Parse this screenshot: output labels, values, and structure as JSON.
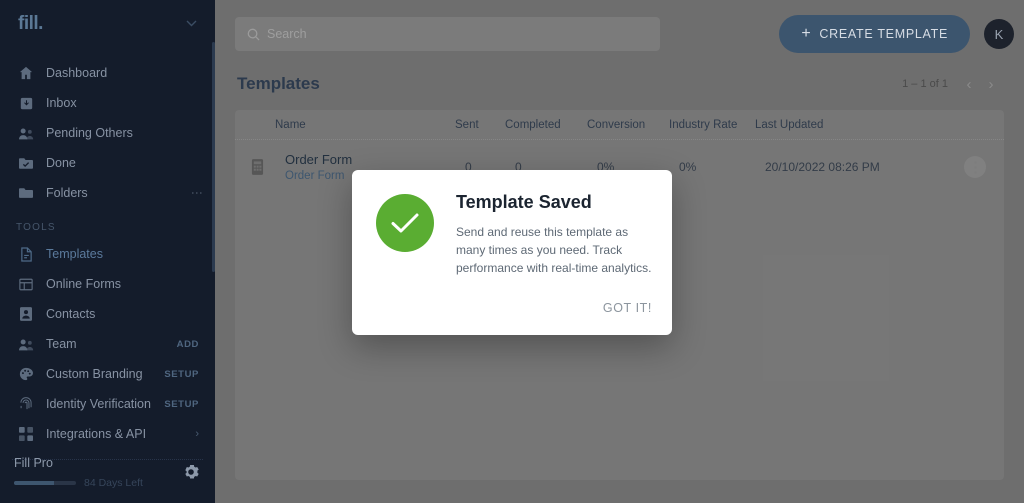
{
  "sidebar": {
    "logo": "fill.",
    "logo_chevron": "chevron-down",
    "nav_primary": [
      {
        "label": "Dashboard",
        "icon": "home-icon"
      },
      {
        "label": "Inbox",
        "icon": "inbox-icon"
      },
      {
        "label": "Pending Others",
        "icon": "pending-users-icon"
      },
      {
        "label": "Done",
        "icon": "folder-check-icon"
      },
      {
        "label": "Folders",
        "icon": "folder-icon",
        "more": "⋮"
      }
    ],
    "section_tools": "TOOLS",
    "nav_tools": [
      {
        "label": "Templates",
        "icon": "template-icon",
        "active": true
      },
      {
        "label": "Online Forms",
        "icon": "form-icon"
      },
      {
        "label": "Contacts",
        "icon": "contact-card-icon"
      },
      {
        "label": "Team",
        "icon": "team-icon",
        "badge": "ADD"
      },
      {
        "label": "Custom Branding",
        "icon": "palette-icon",
        "badge": "SETUP"
      },
      {
        "label": "Identity Verification",
        "icon": "fingerprint-icon",
        "badge": "SETUP"
      },
      {
        "label": "Integrations & API",
        "icon": "integrations-icon",
        "arrow": "›"
      }
    ],
    "plan": {
      "title": "Fill Pro",
      "days_left": "84 Days Left",
      "progress_percent": 65,
      "gear_icon": "gear-icon"
    }
  },
  "topbar": {
    "search_placeholder": "Search",
    "search_icon": "search-icon",
    "search_value": "",
    "create_plus": "+",
    "create_label": "CREATE TEMPLATE",
    "avatar_initial": "K"
  },
  "page": {
    "title": "Templates",
    "pager_label": "1 – 1 of 1",
    "prev_arrow": "‹",
    "next_arrow": "›"
  },
  "table": {
    "columns": [
      "Name",
      "Sent",
      "Completed",
      "Conversion",
      "Industry Rate",
      "Last Updated"
    ],
    "rows": [
      {
        "doc_icon": "document-icon",
        "name": "Order Form",
        "subname": "Order Form",
        "sent": "0",
        "completed": "0",
        "conversion": "0%",
        "industry_rate": "0%",
        "last_updated": "20/10/2022 08:26 PM",
        "more_icon": "more-vertical-icon"
      }
    ]
  },
  "modal": {
    "check_icon": "checkmark-icon",
    "title": "Template Saved",
    "text": "Send and reuse this template as many times as you need. Track performance with real-time analytics.",
    "ok_label": "GOT IT!",
    "accent_green": "#5aad32"
  }
}
